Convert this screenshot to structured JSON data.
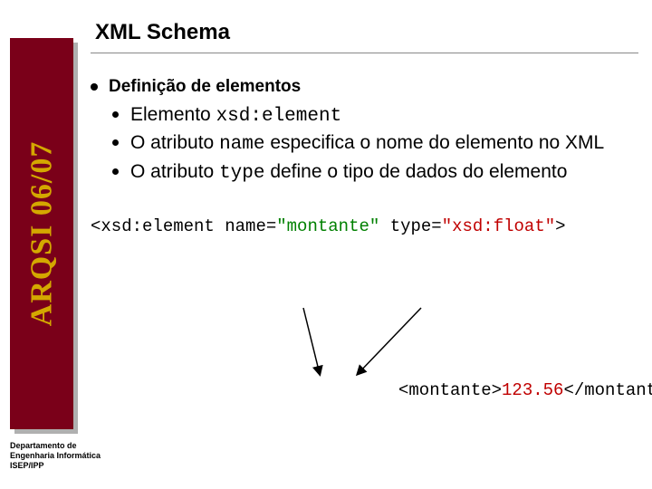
{
  "sidebar": {
    "label": "ARQSI 06/07"
  },
  "title": "XML Schema",
  "main": {
    "heading": "Definição de elementos",
    "items": [
      {
        "pre": "Elemento ",
        "code": "xsd:element",
        "post": ""
      },
      {
        "pre": "O atributo ",
        "code": "name",
        "post": " especifica o nome do elemento no XML"
      },
      {
        "pre": "O atributo ",
        "code": "type",
        "post": " define o tipo de dados do elemento"
      }
    ]
  },
  "code": {
    "open": "<xsd:element ",
    "attr1_name": "name=",
    "attr1_val": "\"montante\"",
    "sep": " ",
    "attr2_name": "type=",
    "attr2_val": "\"xsd:float\"",
    "close": ">"
  },
  "example": {
    "open": "<montante>",
    "val": "123.56",
    "close": "</montante>"
  },
  "footer": {
    "line1": "Departamento de",
    "line2": "Engenharia Informática",
    "line3": "ISEP/IPP"
  }
}
